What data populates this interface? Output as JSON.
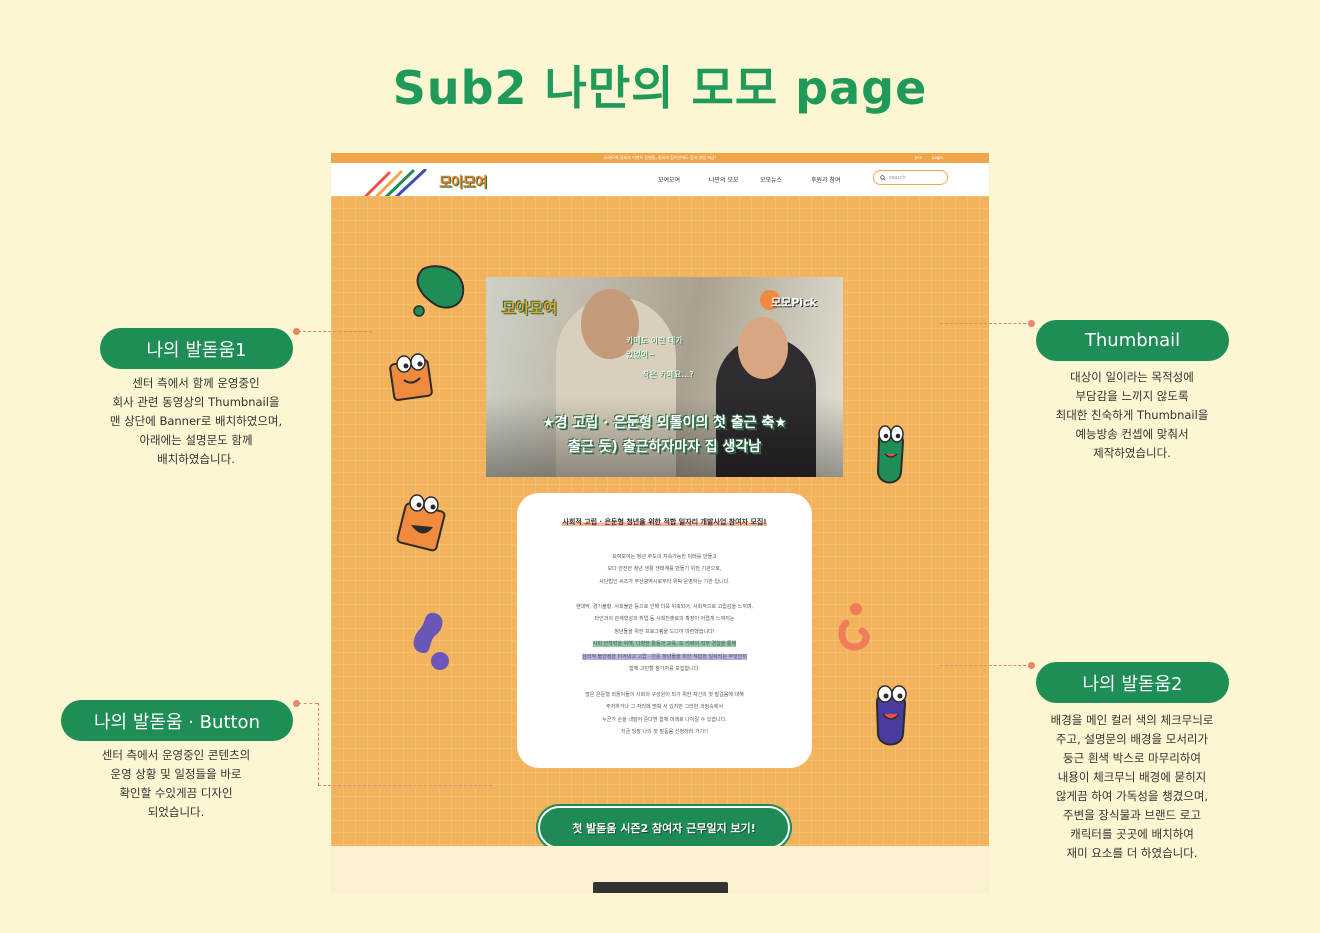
{
  "page_title": "Sub2 나만의 모모 page",
  "mockup": {
    "topbar_text": "모여모여 협회의 이벤트 진행중, 협회의 참여안에도 참여 방법 피급!",
    "auth": {
      "join": "Join",
      "login": "Login"
    },
    "logo": "모아모여",
    "menu": [
      "모여모여",
      "나만의 모모",
      "모모뉴스",
      "후원과 참여"
    ],
    "search_placeholder": "search",
    "thumbnail": {
      "logo": "모아모여",
      "badge": "모모Pick",
      "bubble1": "카페도 이런 데가",
      "bubble2": "있었어~",
      "bubble3": "작은 카페요…?",
      "caption1": "★경 고립 · 은둔형 외톨이의 첫 출근 축★",
      "caption2": "출근 듯) 출근하자마자 집 생각남"
    },
    "card": {
      "title": "사회적 고립 · 은둔형 청년을 위한 적합 일자리 개발사업 참여자 모집!",
      "para1": [
        "모여모여는 청년 주도의 지속가능한 미래를 만들고",
        "보다 안전한 청년 생활 생태계를 만들기 위한 기관으로,",
        "사단법인 씨즈가 부산광역시로부터 위탁 운영하는 기관 입니다."
      ],
      "para2": [
        "현대막, 경기불황, 사회불안 등으로 인해 더욱 위축되어, 사회적으로 고립감을 느끼며,",
        "타인과의 관계형성과 취업 등 사회진출로의 확장이 어렵게 느껴지는",
        "청년들을 위한 프로그램을 드디어 마련했습니다!"
      ],
      "para2_hl1": "사회 안착력을 위해, 다양한 활동과 교육, 또 카페의 직무 경험을 통해",
      "para2_hl2": "심리적 불안정을 이겨내고 고립 · 은둔 청년들을 위한 적합한 일자리는 무엇인지",
      "para2_end": "함께 고민할 참가자를 모집합니다.",
      "para3": [
        "많은 은둔형 외톨이들이 사회의 구성원이 되기 위한 자신의 첫 발걸음에 대해",
        "주저하거나 그 자리에 멈춰 서 있지만 그러한 과정속에서",
        "누군가 손을 내밀어 준다면 함께 미래로 나아갈 수 있습니다.",
        "지금 당장 나의 첫 발돋움 신청하러 가기!!"
      ]
    },
    "cta_label": "첫 발돋움 시즌2 참여자 근무일지 보기!"
  },
  "annotations": {
    "left1": {
      "title": "나의 발돋움1",
      "lines": [
        "센터 측에서 함께 운영중인",
        "회사 관련 동영상의 Thumbnail을",
        "맨 상단에 Banner로 배치하였으며,",
        "아래에는 설명문도 함께",
        "배치하였습니다."
      ]
    },
    "left2": {
      "title": "나의 발돋움 · Button",
      "lines": [
        "센터 측에서 운영중인 콘텐츠의",
        "운영 상황 및 일정들을 바로",
        "확인할 수있게끔 디자인",
        "되었습니다."
      ]
    },
    "right1": {
      "title": "Thumbnail",
      "lines": [
        "대상이 일이라는 목적성에",
        "부담감을 느끼지 않도록",
        "최대한 친숙하게 Thumbnail을",
        "예능방송 컨셉에 맞춰서",
        "제작하였습니다."
      ]
    },
    "right2": {
      "title": "나의 발돋움2",
      "lines": [
        "배경을 메인 컬러 색의 체크무늬로",
        "주고, 설명문의 배경을 모서리가",
        "둥근 흰색 박스로 마무리하여",
        "내용이 체크무늬 배경에 묻히지",
        "않게끔 하여 가독성을 챙겼으며,",
        "주변을 장식물과 브랜드 로고",
        "캐릭터를 곳곳에 배치하여",
        "재미 요소를 더 하였습니다."
      ]
    }
  },
  "colors": {
    "brand_green": "#1f8d56",
    "brand_orange": "#f3b35d",
    "background": "#fdf6d2"
  }
}
